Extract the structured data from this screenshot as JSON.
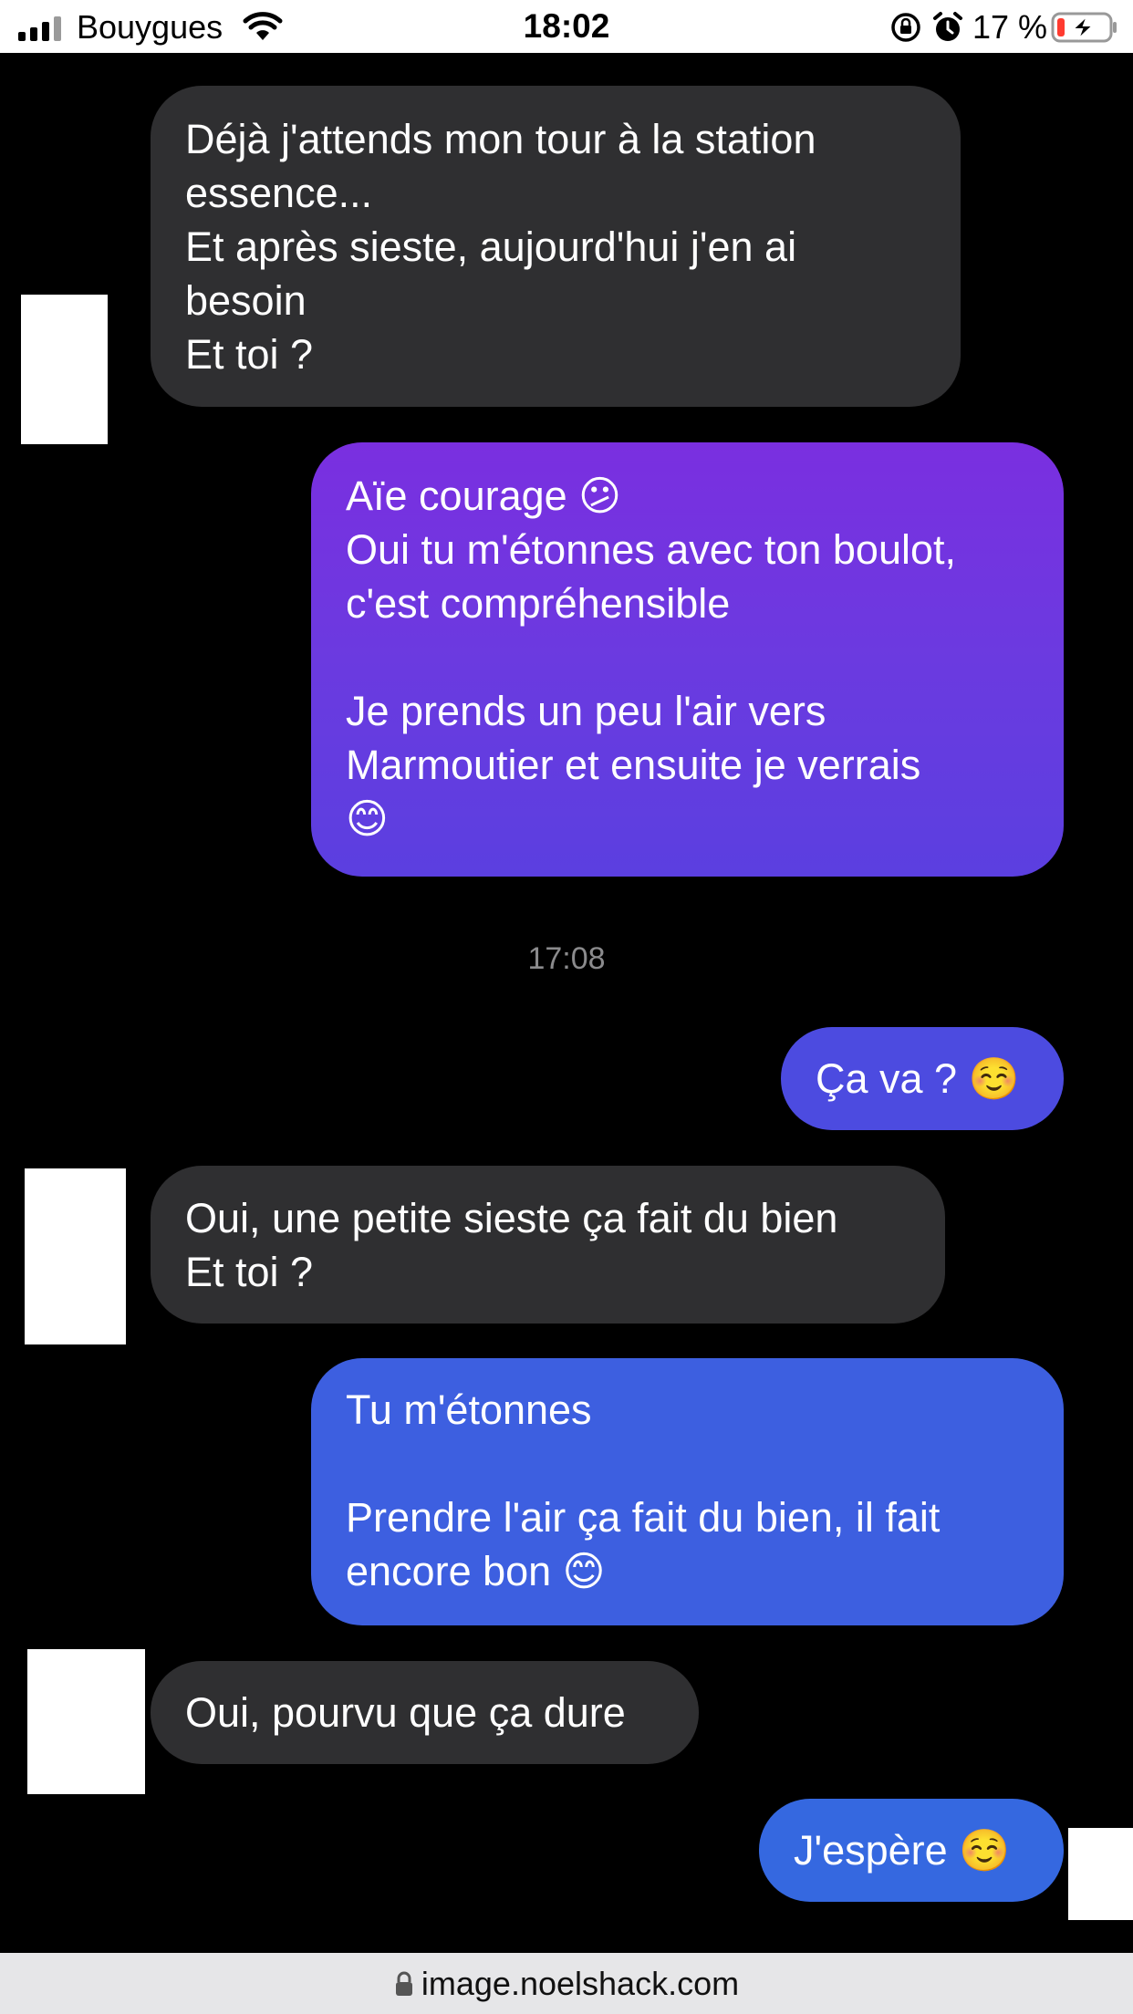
{
  "status_bar": {
    "carrier": "Bouygues",
    "time": "18:02",
    "battery_percent": "17 %",
    "icons": [
      "signal-icon",
      "wifi-icon",
      "rotation-lock-icon",
      "alarm-icon",
      "battery-charging-icon"
    ]
  },
  "messages": [
    {
      "id": "m1",
      "direction": "received",
      "text": "Déjà j'attends mon tour à la station\nessence...\nEt après sieste, aujourd'hui j'en ai\nbesoin\nEt toi ?"
    },
    {
      "id": "m2",
      "direction": "sent",
      "text": "Aïe courage 😕\nOui tu m'étonnes avec ton boulot,\nc'est compréhensible\n\nJe prends un peu l'air vers\nMarmoutier et ensuite je verrais\n😊"
    },
    {
      "id": "m3",
      "direction": "sent",
      "text": "Ça va ? ☺️"
    },
    {
      "id": "m4",
      "direction": "received",
      "text": "Oui, une petite sieste ça fait du bien\nEt toi ?"
    },
    {
      "id": "m5",
      "direction": "sent",
      "text": "Tu m'étonnes\n\nPrendre l'air ça fait du bien, il fait\nencore bon 😊"
    },
    {
      "id": "m6",
      "direction": "received",
      "text": "Oui, pourvu que ça dure"
    },
    {
      "id": "m7",
      "direction": "sent",
      "text": "J'espère ☺️"
    }
  ],
  "time_separator": "17:08",
  "url_bar": {
    "url": "image.noelshack.com"
  },
  "colors": {
    "background": "#000000",
    "received_bubble": "#2f2f31",
    "sent_gradient_top": "#7a2fe0",
    "sent_gradient_bottom": "#3467e0",
    "url_bar": "#e6e6e8"
  }
}
